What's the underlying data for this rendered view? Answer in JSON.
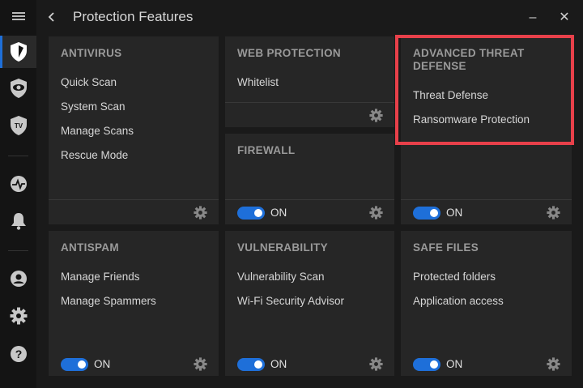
{
  "window": {
    "title": "Protection Features",
    "back_icon": "chevron-left-icon",
    "minimize_label": "–",
    "close_label": "✕"
  },
  "sidebar": {
    "items": [
      {
        "name": "menu-icon",
        "active": false
      },
      {
        "name": "shield-icon",
        "active": true
      },
      {
        "name": "eye-shield-icon",
        "active": false
      },
      {
        "name": "tv-shield-icon",
        "active": false
      },
      {
        "name": "activity-icon",
        "active": false
      },
      {
        "name": "bell-icon",
        "active": false
      },
      {
        "name": "account-icon",
        "active": false
      },
      {
        "name": "settings-icon",
        "active": false
      },
      {
        "name": "help-icon",
        "active": false
      }
    ]
  },
  "panels": {
    "antivirus": {
      "title": "ANTIVIRUS",
      "links": [
        "Quick Scan",
        "System Scan",
        "Manage Scans",
        "Rescue Mode"
      ]
    },
    "web_protection": {
      "title": "WEB PROTECTION",
      "links": [
        "Whitelist"
      ]
    },
    "advanced_threat_defense": {
      "title": "ADVANCED THREAT DEFENSE",
      "links": [
        "Threat Defense",
        "Ransomware Protection"
      ],
      "toggle": "ON"
    },
    "firewall": {
      "title": "FIREWALL",
      "toggle": "ON"
    },
    "antispam": {
      "title": "ANTISPAM",
      "links": [
        "Manage Friends",
        "Manage Spammers"
      ],
      "toggle": "ON"
    },
    "vulnerability": {
      "title": "VULNERABILITY",
      "links": [
        "Vulnerability Scan",
        "Wi-Fi Security Advisor"
      ],
      "toggle": "ON"
    },
    "safe_files": {
      "title": "SAFE FILES",
      "links": [
        "Protected folders",
        "Application access"
      ],
      "toggle": "ON"
    }
  },
  "colors": {
    "accent": "#1e6fd9",
    "highlight": "#e8404a",
    "background": "#1a1a1a",
    "panel": "#262626"
  }
}
